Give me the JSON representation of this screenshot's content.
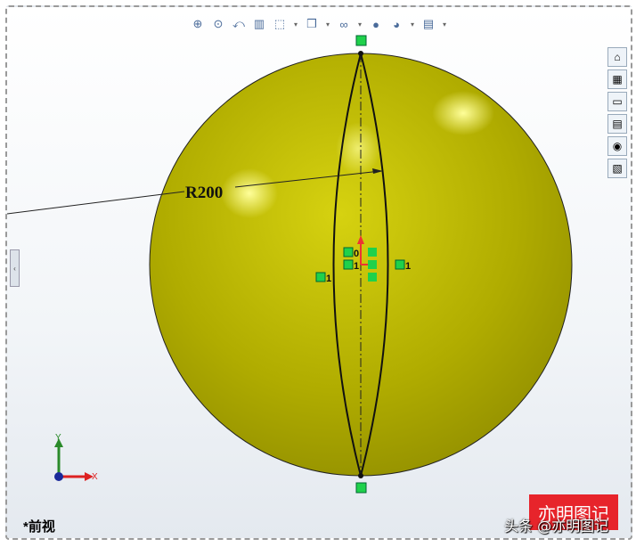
{
  "toolbar": {
    "items": [
      {
        "name": "zoom-to-fit-icon",
        "glyph": "⊕"
      },
      {
        "name": "zoom-to-area-icon",
        "glyph": "⊙"
      },
      {
        "name": "previous-view-icon",
        "glyph": "⤺"
      },
      {
        "name": "section-view-icon",
        "glyph": "▥"
      },
      {
        "name": "view-orientation-icon",
        "glyph": "⬚",
        "dropdown": true
      },
      {
        "name": "display-style-icon",
        "glyph": "❒",
        "dropdown": true
      },
      {
        "name": "hide-show-items-icon",
        "glyph": "∞",
        "dropdown": true
      },
      {
        "name": "edit-appearance-icon",
        "glyph": "●"
      },
      {
        "name": "apply-scene-icon",
        "glyph": "◕",
        "dropdown": true
      },
      {
        "name": "view-settings-icon",
        "glyph": "▤",
        "dropdown": true
      }
    ]
  },
  "taskpane": {
    "items": [
      {
        "name": "home-icon",
        "glyph": "⌂"
      },
      {
        "name": "design-library-icon",
        "glyph": "▦"
      },
      {
        "name": "file-explorer-icon",
        "glyph": "▭"
      },
      {
        "name": "view-palette-icon",
        "glyph": "▤"
      },
      {
        "name": "appearances-icon",
        "glyph": "◉"
      },
      {
        "name": "custom-properties-icon",
        "glyph": "▧"
      }
    ]
  },
  "sketch": {
    "dimension": "R200",
    "constraint_labels": [
      "0",
      "1",
      "1",
      "1"
    ],
    "colors": {
      "sphere": "#b8b400",
      "relation": "#1fd14b",
      "origin": "#e33"
    }
  },
  "triad": {
    "x": "X",
    "y": "Y"
  },
  "view_label": "*前视",
  "left_tab": "‹",
  "stamp_text": "亦明图记",
  "watermark": "头条 @亦明图记"
}
